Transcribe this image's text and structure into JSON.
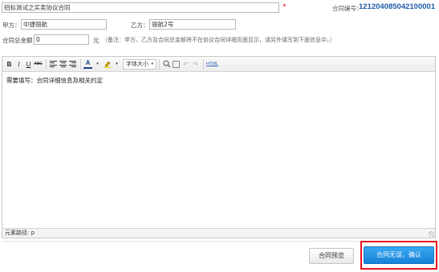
{
  "form": {
    "title_value": "招标测试之买卖协议合同",
    "required_mark": "*",
    "contract_no_label": "合同编号：",
    "contract_no_value": "121204085042100001",
    "party_a_label": "甲方：",
    "party_a_value": "中捷丽航",
    "party_b_label": "乙方：",
    "party_b_value": "丽航2号",
    "amount_label": "合同总金额：",
    "amount_value": "0",
    "amount_unit": "元",
    "amount_note": "（备注：甲方、乙方及合同总金额将不在协议合同详细页面显示，请另外填写到下面信息中。）"
  },
  "toolbar": {
    "bold": "B",
    "italic": "I",
    "underline": "U",
    "strikethrough": "ABC",
    "font_color": "A",
    "font_size": "字体大小",
    "html_source": "HTML"
  },
  "editor": {
    "content": "需要填写：合同详细信息及相关约定",
    "status": "元素路径: p"
  },
  "actions": {
    "preview_label": "合同预览",
    "confirm_label": "合同无误，确认"
  },
  "colors": {
    "accent_blue": "#1682d8",
    "highlight_red": "#e8121e",
    "contract_no": "#1f5ca8"
  }
}
